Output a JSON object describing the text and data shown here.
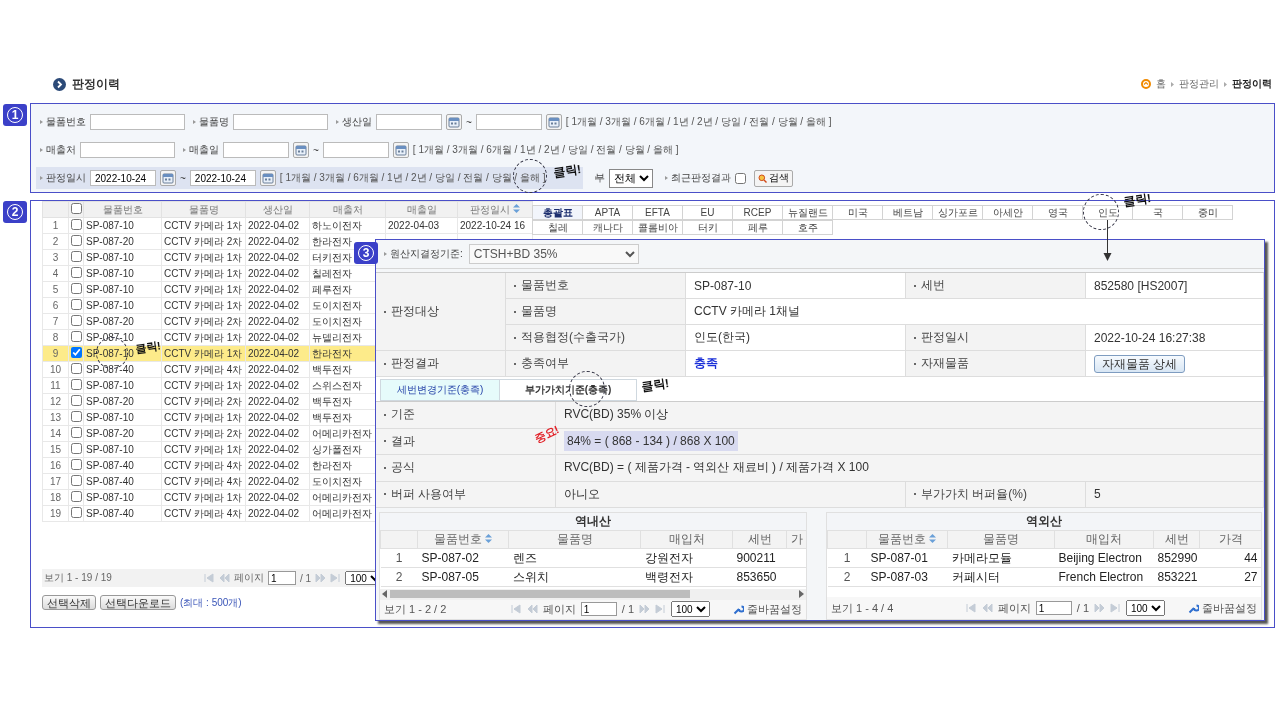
{
  "header": {
    "title": "판정이력",
    "breadcrumb": [
      {
        "label": "홈",
        "current": false
      },
      {
        "label": "판정관리",
        "current": false
      },
      {
        "label": "판정이력",
        "current": true
      }
    ]
  },
  "search": {
    "marker": "1",
    "rows": [
      {
        "fields": [
          {
            "kind": "text",
            "label": "물품번호"
          },
          {
            "kind": "text",
            "label": "물품명"
          },
          {
            "kind": "range",
            "label": "생산일",
            "separator": "~",
            "periods": "[ 1개월 / 3개월 / 6개월 / 1년 / 2년 / 당일 / 전월 / 당월 / 올해 ]",
            "highlighted": false
          }
        ]
      },
      {
        "fields": [
          {
            "kind": "text",
            "label": "매출처"
          },
          {
            "kind": "range",
            "label": "매출일",
            "separator": "~",
            "periods": "[ 1개월 / 3개월 / 6개월 / 1년 / 2년 / 당일 / 전월 / 당월 / 올해 ]",
            "highlighted": false
          }
        ]
      },
      {
        "fields": [
          {
            "kind": "range",
            "label": "판정일시",
            "from": "2022-10-24",
            "separator": "~",
            "to": "2022-10-24",
            "periods": "[ 1개월 / 3개월 / 6개월 / 1년 / 2년 / 당일 / 전월 / 당월 / 올해 ]",
            "highlighted": true,
            "annotation": {
              "kind": "click",
              "text": "클릭!"
            }
          },
          {
            "kind": "select",
            "label": "부",
            "value": "전체"
          },
          {
            "kind": "check",
            "label": "최근판정결과",
            "checked": false
          },
          {
            "kind": "button",
            "label": "검색"
          }
        ]
      }
    ]
  },
  "results": {
    "marker": "2",
    "table": {
      "all_checked": false,
      "columns": [
        {
          "label": "물품번호",
          "sorted": false
        },
        {
          "label": "물품명",
          "sorted": false
        },
        {
          "label": "생산일",
          "sorted": false
        },
        {
          "label": "매출처",
          "sorted": false
        },
        {
          "label": "매출일",
          "sorted": false
        },
        {
          "label": "판정일시",
          "sorted": true
        }
      ],
      "rows": [
        {
          "no": "1",
          "checked": false,
          "selected": false,
          "cells": [
            "SP-087-10",
            "CCTV 카메라 1차",
            "2022-04-02",
            "하노이전자",
            "2022-04-03",
            "2022-10-24 16"
          ]
        },
        {
          "no": "2",
          "checked": false,
          "selected": false,
          "cells": [
            "SP-087-20",
            "CCTV 카메라 2차",
            "2022-04-02",
            "한라전자"
          ]
        },
        {
          "no": "3",
          "checked": false,
          "selected": false,
          "cells": [
            "SP-087-10",
            "CCTV 카메라 1차",
            "2022-04-02",
            "터키전자"
          ]
        },
        {
          "no": "4",
          "checked": false,
          "selected": false,
          "cells": [
            "SP-087-10",
            "CCTV 카메라 1차",
            "2022-04-02",
            "칠레전자"
          ]
        },
        {
          "no": "5",
          "checked": false,
          "selected": false,
          "cells": [
            "SP-087-10",
            "CCTV 카메라 1차",
            "2022-04-02",
            "페루전자"
          ]
        },
        {
          "no": "6",
          "checked": false,
          "selected": false,
          "cells": [
            "SP-087-10",
            "CCTV 카메라 1차",
            "2022-04-02",
            "도이치전자"
          ]
        },
        {
          "no": "7",
          "checked": false,
          "selected": false,
          "cells": [
            "SP-087-20",
            "CCTV 카메라 2차",
            "2022-04-02",
            "도이치전자"
          ]
        },
        {
          "no": "8",
          "checked": false,
          "selected": false,
          "cells": [
            "SP-087-10",
            "CCTV 카메라 1차",
            "2022-04-02",
            "뉴델리전자"
          ]
        },
        {
          "no": "9",
          "checked": true,
          "selected": true,
          "annotation": {
            "kind": "click",
            "text": "클릭!"
          },
          "cells": [
            "SP-087-10",
            "CCTV 카메라 1차",
            "2022-04-02",
            "한라전자"
          ]
        },
        {
          "no": "10",
          "checked": false,
          "selected": false,
          "cells": [
            "SP-087-40",
            "CCTV 카메라 4차",
            "2022-04-02",
            "백두전자"
          ]
        },
        {
          "no": "11",
          "checked": false,
          "selected": false,
          "cells": [
            "SP-087-10",
            "CCTV 카메라 1차",
            "2022-04-02",
            "스위스전자"
          ]
        },
        {
          "no": "12",
          "checked": false,
          "selected": false,
          "cells": [
            "SP-087-20",
            "CCTV 카메라 2차",
            "2022-04-02",
            "백두전자"
          ]
        },
        {
          "no": "13",
          "checked": false,
          "selected": false,
          "cells": [
            "SP-087-10",
            "CCTV 카메라 1차",
            "2022-04-02",
            "백두전자"
          ]
        },
        {
          "no": "14",
          "checked": false,
          "selected": false,
          "cells": [
            "SP-087-20",
            "CCTV 카메라 2차",
            "2022-04-02",
            "어메리카전자"
          ]
        },
        {
          "no": "15",
          "checked": false,
          "selected": false,
          "cells": [
            "SP-087-10",
            "CCTV 카메라 1차",
            "2022-04-02",
            "싱가폴전자"
          ]
        },
        {
          "no": "16",
          "checked": false,
          "selected": false,
          "cells": [
            "SP-087-40",
            "CCTV 카메라 4차",
            "2022-04-02",
            "한라전자"
          ]
        },
        {
          "no": "17",
          "checked": false,
          "selected": false,
          "cells": [
            "SP-087-40",
            "CCTV 카메라 4차",
            "2022-04-02",
            "도이치전자"
          ]
        },
        {
          "no": "18",
          "checked": false,
          "selected": false,
          "cells": [
            "SP-087-10",
            "CCTV 카메라 1차",
            "2022-04-02",
            "어메리카전자"
          ]
        },
        {
          "no": "19",
          "checked": false,
          "selected": false,
          "cells": [
            "SP-087-40",
            "CCTV 카메라 4차",
            "2022-04-02",
            "어메리카전자"
          ]
        }
      ],
      "footer": {
        "summary": "보기 1 - 19 / 19",
        "page_label": "페이지",
        "page": "1",
        "page_total": "/ 1",
        "page_size": "100"
      }
    },
    "actions": [
      "선택삭제",
      "선택다운로드"
    ],
    "limit_note": "(최대 : 500개)",
    "agreement_tabs": [
      [
        {
          "label": "총괄표",
          "selected": true
        },
        {
          "label": "APTA",
          "selected": false
        },
        {
          "label": "EFTA",
          "selected": false
        },
        {
          "label": "EU",
          "selected": false
        },
        {
          "label": "RCEP",
          "selected": false
        },
        {
          "label": "뉴질랜드",
          "selected": false
        },
        {
          "label": "미국",
          "selected": false
        },
        {
          "label": "베트남",
          "selected": false
        },
        {
          "label": "싱가포르",
          "selected": false
        },
        {
          "label": "아세안",
          "selected": false
        },
        {
          "label": "영국",
          "selected": false
        },
        {
          "label": "인도",
          "selected": false,
          "annotation": {
            "kind": "pointer",
            "text": "클릭!"
          }
        },
        {
          "label": "국",
          "selected": false
        },
        {
          "label": "중미",
          "selected": false
        }
      ],
      [
        {
          "label": "칠레",
          "selected": false
        },
        {
          "label": "캐나다",
          "selected": false
        },
        {
          "label": "콜롬비아",
          "selected": false
        },
        {
          "label": "터키",
          "selected": false
        },
        {
          "label": "페루",
          "selected": false
        },
        {
          "label": "호주",
          "selected": false
        }
      ]
    ]
  },
  "judgment": {
    "marker": "3",
    "criterion_label": "원산지결정기준:",
    "criterion": "CTSH+BD 35%",
    "info": [
      {
        "group": "판정대상",
        "items": [
          {
            "label": "물품번호",
            "value": "SP-087-10",
            "kind": "text"
          },
          {
            "label": "세번",
            "value": "852580 [HS2007]",
            "kind": "text"
          }
        ]
      },
      {
        "items": [
          {
            "label": "물품명",
            "value": "CCTV 카메라 1채널",
            "kind": "text"
          }
        ]
      },
      {
        "items": [
          {
            "label": "적용협정(수출국가)",
            "value": "인도(한국)",
            "kind": "text"
          },
          {
            "label": "판정일시",
            "value": "2022-10-24 16:27:38",
            "kind": "text"
          }
        ]
      },
      {
        "group": "판정결과",
        "items": [
          {
            "label": "충족여부",
            "value": "충족",
            "kind": "status"
          },
          {
            "label": "자재물품",
            "value": "자재물품 상세",
            "kind": "button"
          }
        ]
      }
    ],
    "detail_tabs": [
      {
        "label": "세번변경기준(충족)",
        "selected": false
      },
      {
        "label": "부가가치기준(충족)",
        "selected": true,
        "annotation": {
          "kind": "click",
          "text": "클릭!"
        }
      }
    ],
    "detail": [
      {
        "label": "기준",
        "value": "RVC(BD) 35% 이상",
        "highlighted": false
      },
      {
        "label": "결과",
        "value": "84% = ( 868 - 134 ) / 868 X 100",
        "highlighted": true,
        "annotation": {
          "kind": "important",
          "text": "중요!"
        }
      },
      {
        "label": "공식",
        "value": "RVC(BD) = ( 제품가격 - 역외산 재료비 ) / 제품가격 X 100",
        "highlighted": false
      },
      {
        "label": "버퍼 사용여부",
        "value": "아니오",
        "highlighted": false,
        "label2": "부가가치 버퍼율(%)",
        "value2": "5"
      }
    ],
    "grids": [
      {
        "title": "역내산",
        "scrollbar": true,
        "columns": [
          {
            "label": "물품번호",
            "sorted": true
          },
          {
            "label": "물품명",
            "sorted": false
          },
          {
            "label": "매입처",
            "sorted": false
          },
          {
            "label": "세번",
            "sorted": false
          },
          {
            "label": "가",
            "sorted": false
          }
        ],
        "rows": [
          {
            "no": "1",
            "cells": [
              "SP-087-02",
              "렌즈",
              "강원전자",
              "900211"
            ]
          },
          {
            "no": "2",
            "cells": [
              "SP-087-05",
              "스위치",
              "백령전자",
              "853650"
            ]
          }
        ],
        "footer": {
          "summary": "보기 1 - 2 / 2",
          "page_label": "페이지",
          "page": "1",
          "page_total": "/ 1",
          "page_size": "100",
          "wrap_label": "줄바꿈설정"
        }
      },
      {
        "title": "역외산",
        "scrollbar": false,
        "columns": [
          {
            "label": "물품번호",
            "sorted": true
          },
          {
            "label": "물품명",
            "sorted": false
          },
          {
            "label": "매입처",
            "sorted": false
          },
          {
            "label": "세번",
            "sorted": false
          },
          {
            "label": "가격",
            "sorted": false
          }
        ],
        "rows": [
          {
            "no": "1",
            "cells": [
              "SP-087-01",
              "카메라모듈",
              "Beijing Electron",
              "852990",
              "44"
            ]
          },
          {
            "no": "2",
            "cells": [
              "SP-087-03",
              "커페시터",
              "French Electron",
              "853221",
              "27"
            ]
          }
        ],
        "footer": {
          "summary": "보기 1 - 4 / 4",
          "page_label": "페이지",
          "page": "1",
          "page_total": "/ 1",
          "page_size": "100",
          "wrap_label": "줄바꿈설정"
        }
      }
    ]
  }
}
